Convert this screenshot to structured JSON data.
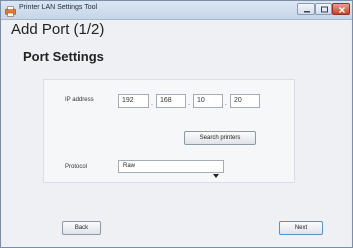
{
  "window": {
    "title": "Printer LAN Settings Tool"
  },
  "page": {
    "title": "Add Port (1/2)",
    "section_title": "Port Settings"
  },
  "ip_address": {
    "label": "IP address",
    "octets": [
      "192",
      "168",
      "10",
      "20"
    ],
    "separator": "."
  },
  "search_button": {
    "label": "Search printers"
  },
  "protocol": {
    "label": "Protocol",
    "selected": "Raw"
  },
  "footer": {
    "back_label": "Back",
    "next_label": "Next"
  },
  "colors": {
    "titlebar": "#c6d5e8",
    "close_button": "#c4462d",
    "background": "#eef0f4"
  }
}
